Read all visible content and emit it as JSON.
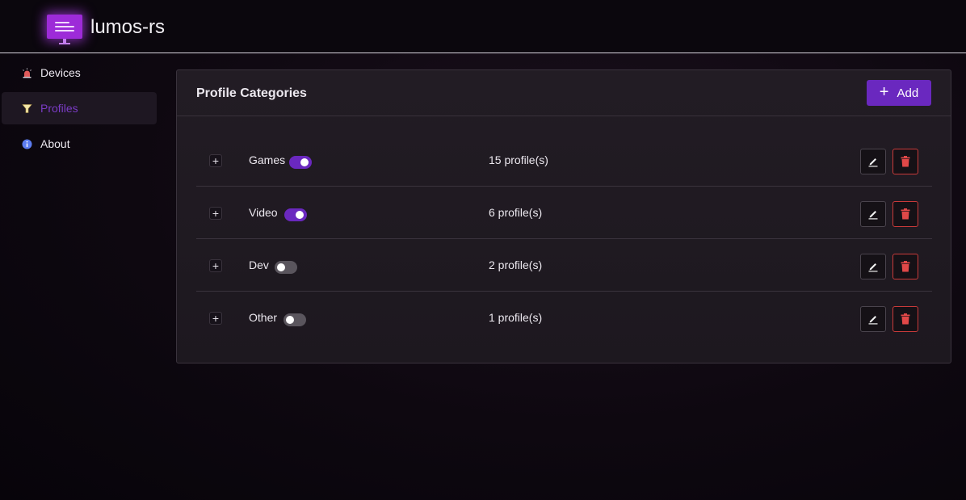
{
  "app": {
    "title": "lumos-rs"
  },
  "sidebar": {
    "items": [
      {
        "label": "Devices",
        "icon": "alarm-icon",
        "active": false
      },
      {
        "label": "Profiles",
        "icon": "filter-icon",
        "active": true
      },
      {
        "label": "About",
        "icon": "info-icon",
        "active": false
      }
    ]
  },
  "card": {
    "title": "Profile Categories",
    "add_label": "Add"
  },
  "categories": [
    {
      "name": "Games",
      "enabled": true,
      "count": "15 profile(s)"
    },
    {
      "name": "Video",
      "enabled": true,
      "count": "6 profile(s)"
    },
    {
      "name": "Dev",
      "enabled": false,
      "count": "2 profile(s)"
    },
    {
      "name": "Other",
      "enabled": false,
      "count": "1 profile(s)"
    }
  ],
  "colors": {
    "accent": "#6a28bf",
    "danger": "#e04848",
    "logo": "#9d2bd8"
  }
}
